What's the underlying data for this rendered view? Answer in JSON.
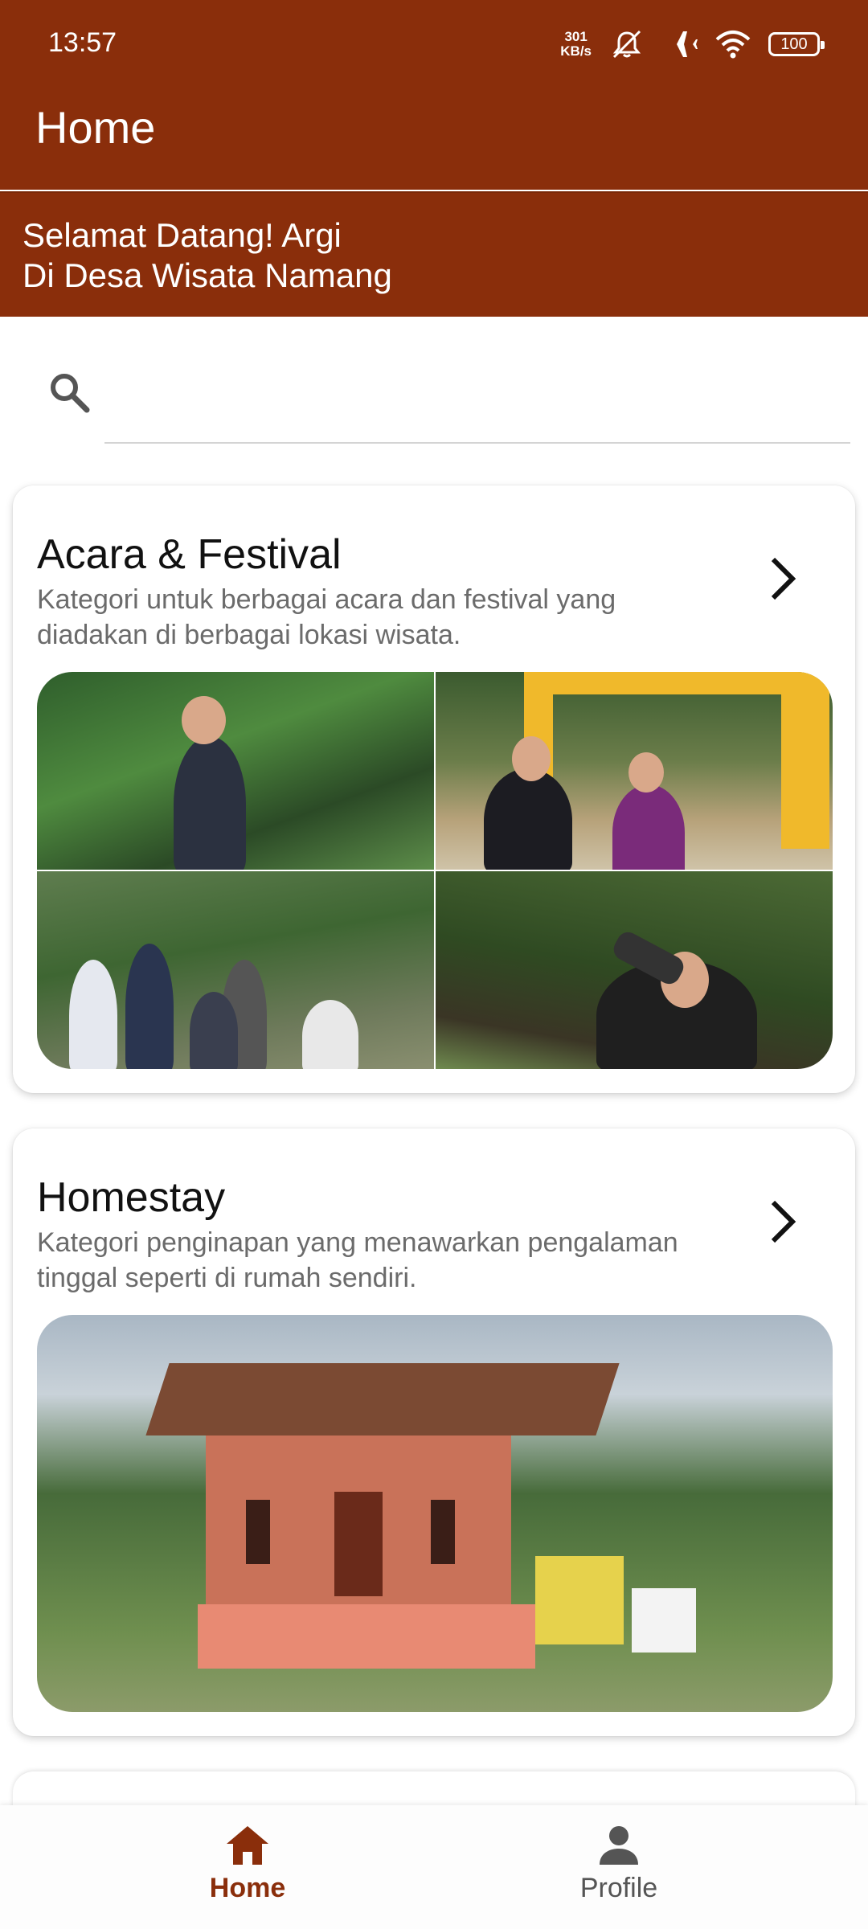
{
  "status_bar": {
    "time": "13:57",
    "network_speed_value": "301",
    "network_speed_unit": "KB/s",
    "battery": "100",
    "icons": [
      "mute-icon",
      "airplane-icon",
      "wifi-icon",
      "battery-icon"
    ]
  },
  "app_bar": {
    "title": "Home"
  },
  "welcome": {
    "line1": "Selamat Datang! Argi",
    "line2": "Di Desa Wisata Namang"
  },
  "search": {
    "value": "",
    "placeholder": ""
  },
  "cards": [
    {
      "title": "Acara & Festival",
      "description": "Kategori untuk berbagai acara dan festival yang diadakan di berbagai lokasi wisata."
    },
    {
      "title": "Homestay",
      "description": "Kategori penginapan yang menawarkan pengalaman tinggal seperti di rumah sendiri."
    }
  ],
  "bottom_nav": {
    "items": [
      {
        "label": "Home",
        "icon": "home-icon",
        "active": true
      },
      {
        "label": "Profile",
        "icon": "person-icon",
        "active": false
      }
    ]
  },
  "colors": {
    "primary": "#8a2e0b",
    "inactive": "#555555",
    "description_text": "#6b6b6b"
  }
}
